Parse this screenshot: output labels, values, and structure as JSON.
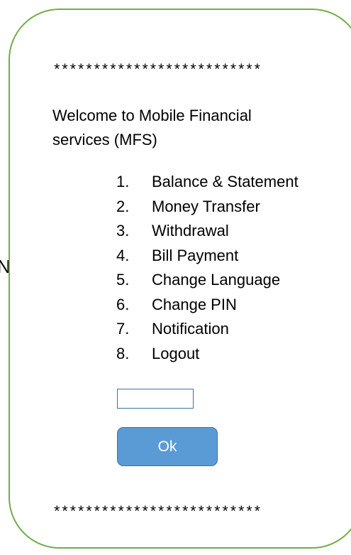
{
  "screen": {
    "stray_glyph": "N",
    "top_stars": "**************************",
    "welcome_text": "Welcome to Mobile Financial services (MFS)",
    "menu": [
      {
        "number": "1.",
        "label": "Balance & Statement"
      },
      {
        "number": "2.",
        "label": "Money Transfer"
      },
      {
        "number": "3.",
        "label": "Withdrawal"
      },
      {
        "number": "4.",
        "label": "Bill Payment"
      },
      {
        "number": "5.",
        "label": "Change Language"
      },
      {
        "number": "6.",
        "label": "Change PIN"
      },
      {
        "number": "7.",
        "label": "Notification"
      },
      {
        "number": "8.",
        "label": "Logout"
      }
    ],
    "input": {
      "value": "",
      "placeholder": ""
    },
    "ok_label": "Ok",
    "bottom_stars": "**************************"
  },
  "colors": {
    "frame_border": "#70ad47",
    "button_fill": "#5b9bd5",
    "button_border": "#41719c",
    "input_border": "#41719c"
  }
}
